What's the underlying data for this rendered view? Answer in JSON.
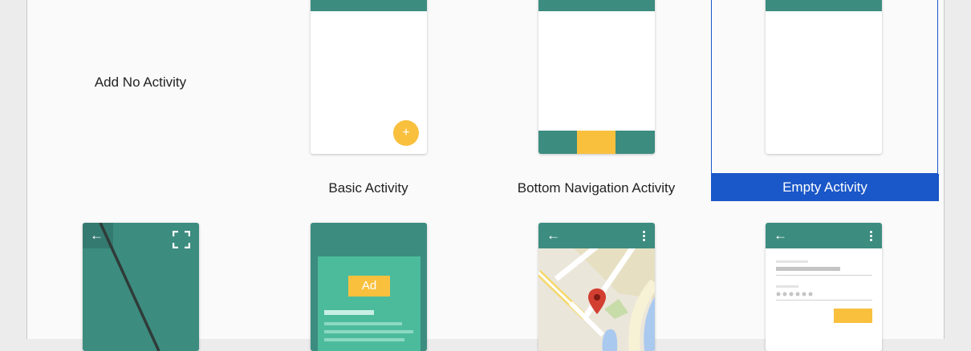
{
  "templates": {
    "no_activity": {
      "label": "Add No Activity"
    },
    "basic": {
      "label": "Basic Activity",
      "fab_symbol": "+"
    },
    "bottom_nav": {
      "label": "Bottom Navigation Activity"
    },
    "empty": {
      "label": "Empty Activity",
      "selected": true
    },
    "fullscreen": {
      "label": ""
    },
    "admob": {
      "label": "",
      "ad_text": "Ad"
    },
    "maps": {
      "label": ""
    },
    "login": {
      "label": ""
    }
  },
  "colors": {
    "teal": "#3d8c80",
    "accent": "#f9c03e",
    "selection": "#1a57c8",
    "ad_green": "#4cbb9c"
  }
}
